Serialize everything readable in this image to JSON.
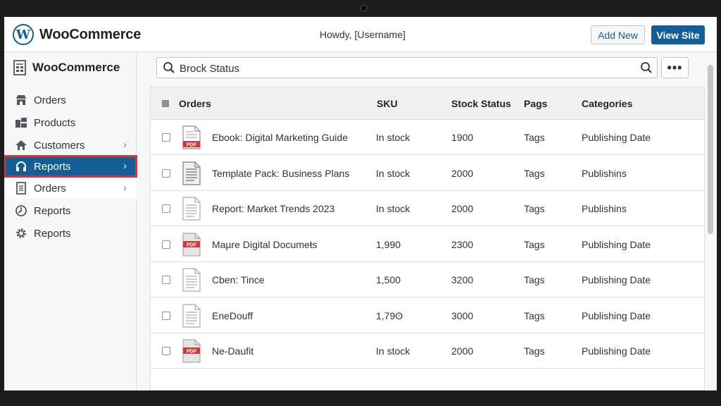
{
  "topbar": {
    "brand": "WooCommerce",
    "logo_letter": "W",
    "howdy": "Howdy, [Username]",
    "add_new": "Add New",
    "view_site": "View Site"
  },
  "sidebar": {
    "title": "WooCommerce",
    "items": [
      {
        "label": "Orders",
        "icon": "store-icon"
      },
      {
        "label": "Products",
        "icon": "products-icon"
      },
      {
        "label": "Customers",
        "icon": "home-icon",
        "chevron": true
      },
      {
        "label": "Reports",
        "icon": "headset-icon",
        "chevron": true,
        "active": true
      },
      {
        "label": "Orders",
        "icon": "document-icon",
        "chevron": true
      },
      {
        "label": "Reports",
        "icon": "clock-icon"
      },
      {
        "label": "Reports",
        "icon": "gear-icon"
      }
    ]
  },
  "search": {
    "value": "Brock Status",
    "more_label": "•••"
  },
  "table": {
    "columns": [
      "Orders",
      "SKU",
      "Stock Status",
      "Pags",
      "Categories"
    ],
    "rows": [
      {
        "icon": "pdf",
        "name": "Ebook: Digital Marketing Guide",
        "sku": "In stock",
        "stock": "1900",
        "pags": "Tags",
        "category": "Publishing Date"
      },
      {
        "icon": "doc",
        "name": "Template Pack: Business Plans",
        "sku": "In stock",
        "stock": "2000",
        "pags": "Tags",
        "category": "Publishins"
      },
      {
        "icon": "doc-light",
        "name": "Report: Market Trends 2023",
        "sku": "In stock",
        "stock": "2000",
        "pags": "Tags",
        "category": "Publishins"
      },
      {
        "icon": "pdf-grey",
        "name": "Maµre Digital Documeŧs",
        "sku": "1,990",
        "stock": "2300",
        "pags": "Tags",
        "category": "Publishing Date"
      },
      {
        "icon": "doc-light",
        "name": "Cben: Tince",
        "sku": "1,500",
        "stock": "3200",
        "pags": "Tags",
        "category": "Publishing Date"
      },
      {
        "icon": "doc-light",
        "name": "EneDouff",
        "sku": "1,79ʘ",
        "stock": "3000",
        "pags": "Tags",
        "category": "Publishing Date"
      },
      {
        "icon": "pdf-grey",
        "name": "Ne-Daufit",
        "sku": "In stock",
        "stock": "2000",
        "pags": "Tags",
        "category": "Publishing Date"
      }
    ]
  },
  "colors": {
    "accent": "#135e96",
    "highlight_border": "#d63638",
    "pdf_red": "#d63638"
  }
}
